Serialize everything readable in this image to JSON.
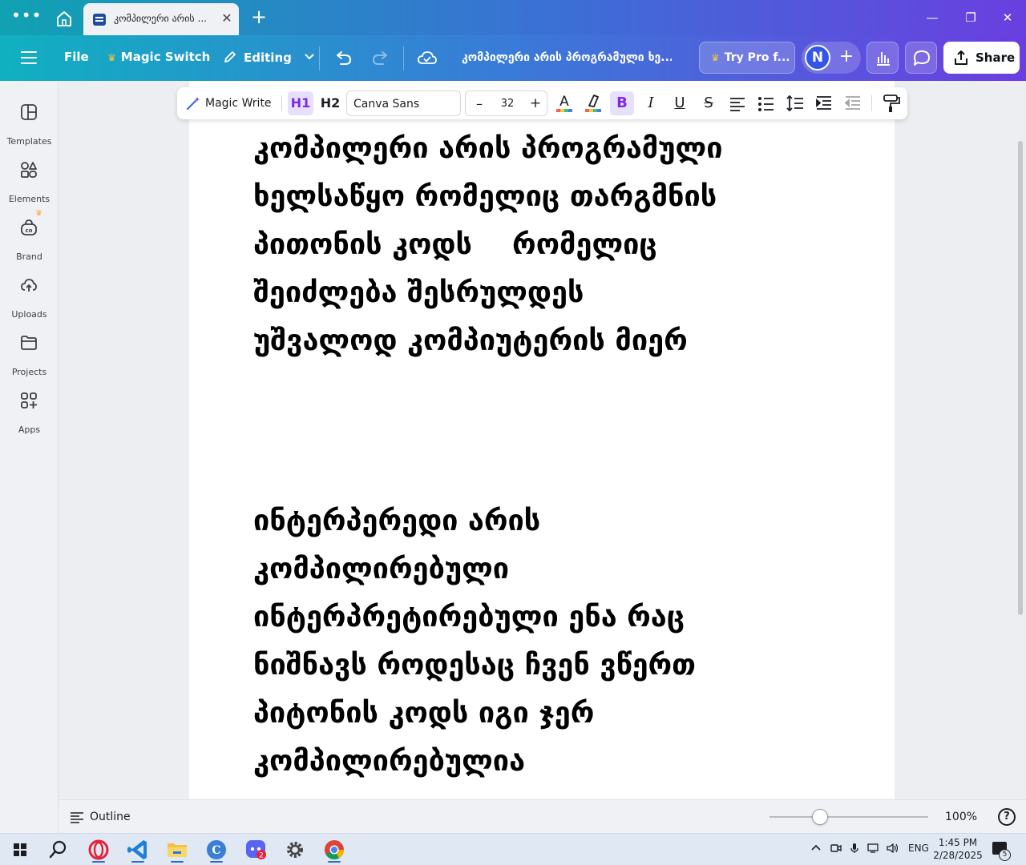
{
  "browser": {
    "tab_title": "კომპილერი არის ...",
    "close_glyph": "✕",
    "new_tab_glyph": "+",
    "window_controls": {
      "minimize": "—",
      "maximize": "❐",
      "close": "✕"
    }
  },
  "header": {
    "file_label": "File",
    "magic_switch_label": "Magic Switch",
    "editing_label": "Editing",
    "doc_title": "კომპილერი არის პროგრამული ხე...",
    "try_pro_label": "Try Pro f...",
    "avatar_initial": "N",
    "share_label": "Share",
    "crown_glyph": "♛"
  },
  "sidebar": {
    "items": [
      {
        "label": "Templates",
        "icon": "templates-icon"
      },
      {
        "label": "Elements",
        "icon": "elements-icon"
      },
      {
        "label": "Brand",
        "icon": "brand-icon"
      },
      {
        "label": "Uploads",
        "icon": "uploads-icon"
      },
      {
        "label": "Projects",
        "icon": "projects-icon"
      },
      {
        "label": "Apps",
        "icon": "apps-icon"
      }
    ]
  },
  "toolbar": {
    "magic_write_label": "Magic Write",
    "h1_label": "H1",
    "h2_label": "H2",
    "font_name": "Canva Sans",
    "font_size": "32",
    "bold_label": "B",
    "italic_label": "I",
    "underline_label": "U",
    "strike_label": "S",
    "minus": "–",
    "plus": "+",
    "accent_color": "#7d2ae8"
  },
  "document": {
    "paragraph1": [
      "კომპილერი არის პროგრამული",
      "ხელსაწყო რომელიც თარგმნის",
      "პითონის კოდს    რომელიც",
      "შეიძლება შესრულდეს",
      "უშვალოდ კომპიუტერის მიერ"
    ],
    "paragraph2": [
      "ინტერპერედი არის",
      "კომპილირებული",
      "ინტერპრეტირებული ენა რაც",
      "ნიშნავს როდესაც ჩვენ ვწერთ",
      "პიტონის კოდს იგი ჯერ",
      "კომპილირებულია"
    ]
  },
  "statusbar": {
    "outline_label": "Outline",
    "zoom_percent": "100%",
    "zoom_slider_fraction": 0.32,
    "help_label": "?"
  },
  "taskbar": {
    "apps": [
      "start-icon",
      "search-icon",
      "opera-icon",
      "vscode-icon",
      "file-explorer-icon",
      "canva-icon",
      "discord-icon",
      "settings-icon",
      "chrome-icon"
    ],
    "discord_badge": "2",
    "language": "ENG",
    "time": "1:45 PM",
    "date": "2/28/2025",
    "notification_count": "5"
  }
}
